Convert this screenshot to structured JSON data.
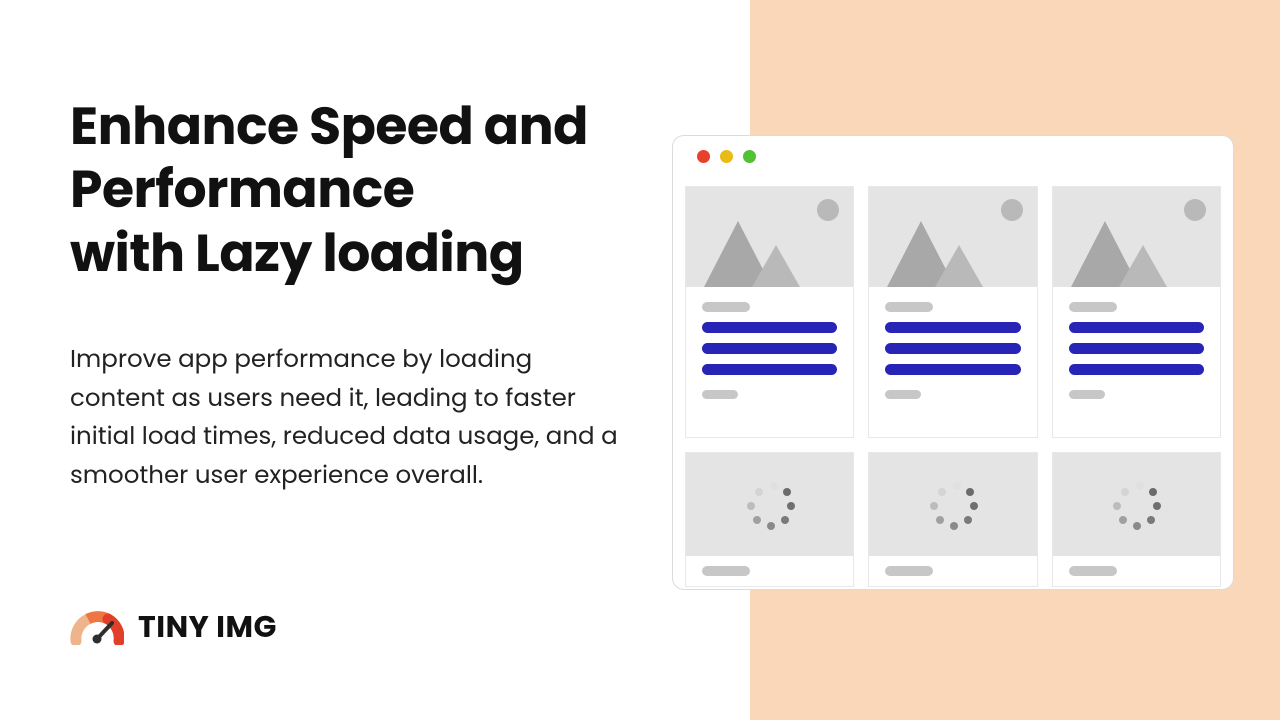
{
  "headline_line1": "Enhance Speed and Performance",
  "headline_line2": "with Lazy loading",
  "body": "Improve app performance by loading content as users need it, leading to faster initial load times, reduced data usage, and a smoother user experience overall.",
  "logo_text": "TINY IMG"
}
